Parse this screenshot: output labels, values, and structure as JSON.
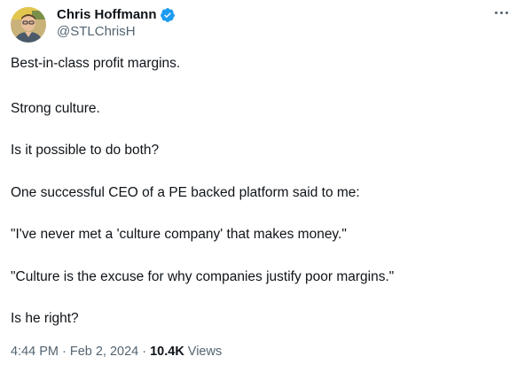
{
  "author": {
    "display_name": "Chris Hoffmann",
    "handle": "@STLChrisH",
    "verified": true,
    "avatar_icon": "user-avatar"
  },
  "tweet": {
    "paragraphs": [
      "Best-in-class profit margins.",
      "Strong culture.",
      "Is it possible to do both?",
      "One successful CEO of a PE backed platform said to me:",
      "\"I've never met a 'culture company' that makes money.\"",
      "\"Culture is the excuse for why companies justify poor margins.\"",
      "Is he right?"
    ]
  },
  "meta": {
    "time": "4:44 PM",
    "separator": "·",
    "date": "Feb 2, 2024",
    "views_count": "10.4K",
    "views_label": "Views"
  },
  "colors": {
    "verified_badge": "#1d9bf0",
    "secondary_text": "#536471",
    "primary_text": "#0f1419"
  }
}
